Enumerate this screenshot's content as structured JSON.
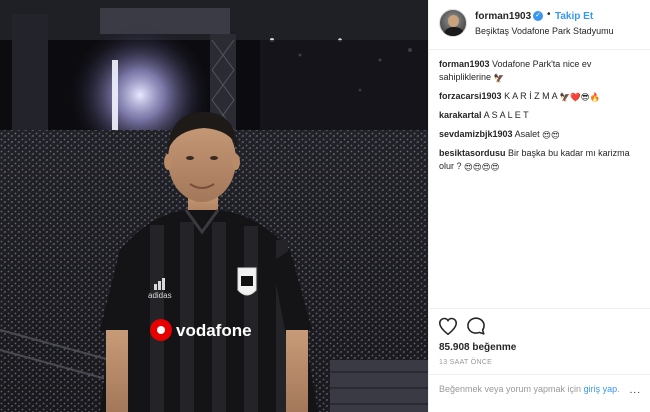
{
  "header": {
    "username": "forman1903",
    "follow_label": "Takip Et",
    "location": "Beşiktaş Vodafone Park Stadyumu",
    "dot": "•"
  },
  "photo": {
    "jersey_sponsor": "vodafone",
    "jersey_brand": "adidas"
  },
  "comments": [
    {
      "user": "forman1903",
      "text": "Vodafone Park'ta nice ev sahipliklerine",
      "emoji": "🦅"
    },
    {
      "user": "forzacarsi1903",
      "text": "K A R İ Z M A",
      "emoji": "🦅❤️😎🔥"
    },
    {
      "user": "karakartal",
      "text": "A S A L E T",
      "emoji": ""
    },
    {
      "user": "sevdamizbjk1903",
      "text": "Asalet",
      "emoji": "😍😍"
    },
    {
      "user": "besiktasordusu",
      "text": "Bir başka bu kadar mı karizma olur ?",
      "emoji": "😍😍😍😍"
    }
  ],
  "actions": {
    "likes": "85.908 beğenme",
    "time": "13 SAAT ÖNCE"
  },
  "login": {
    "prefix": "Beğenmek veya yorum yapmak için ",
    "link": "giriş yap",
    "suffix": ".",
    "more": "..."
  },
  "colors": {
    "accent": "#3897f0",
    "text": "#262626",
    "muted": "#999999",
    "border": "#efefef"
  },
  "icons": [
    "verified-badge-icon",
    "heart-icon",
    "comment-icon",
    "more-options-icon"
  ]
}
